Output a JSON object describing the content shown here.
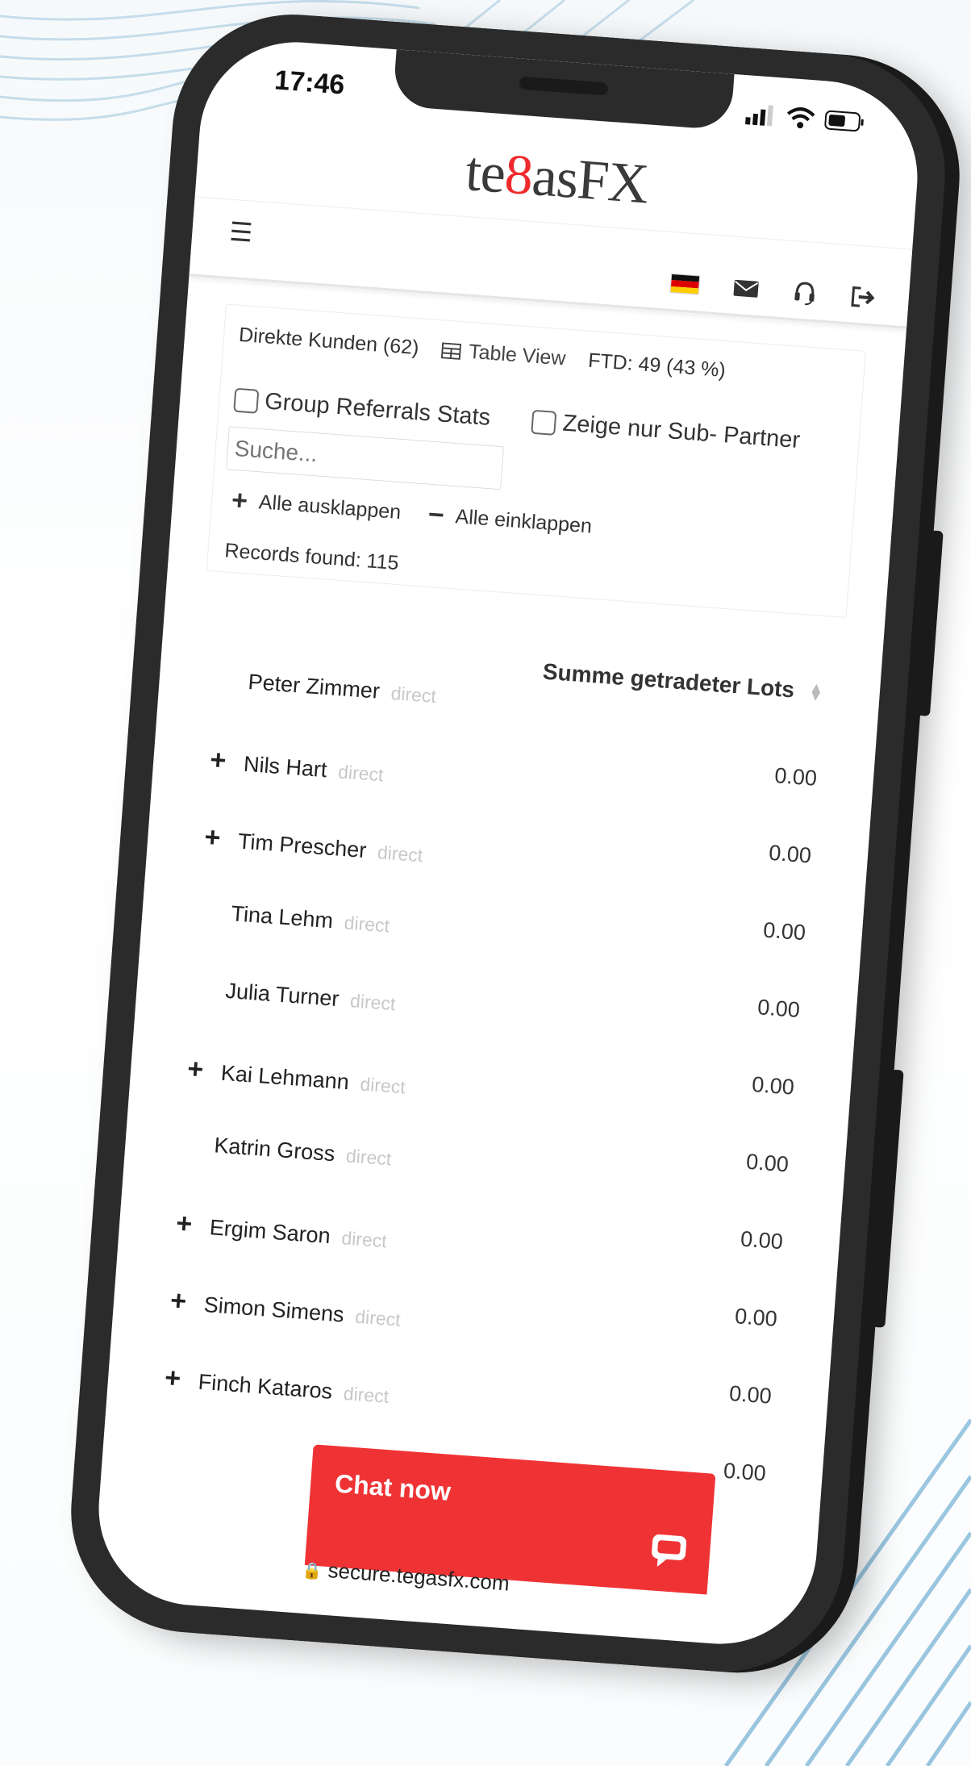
{
  "status_bar": {
    "time": "17:46"
  },
  "brand": {
    "logo_prefix": "te",
    "logo_eight": "8",
    "logo_suffix": "asFX",
    "accent": "#ef2b2d"
  },
  "topbar": {
    "menu_icon": "hamburger-icon",
    "icons": [
      "german-flag-icon",
      "envelope-icon",
      "headset-icon",
      "logout-icon"
    ]
  },
  "filters": {
    "direct_clients": "Direkte Kunden (62)",
    "table_view": "Table View",
    "ftd": "FTD: 49 (43 %)",
    "group_referrals": "Group Referrals Stats",
    "sub_partner": "Zeige nur Sub- Partner",
    "search_placeholder": "Suche...",
    "expand_all": "Alle ausklappen",
    "collapse_all": "Alle einklappen",
    "records": "Records found: 115"
  },
  "table": {
    "column_header": "Summe getradeter Lots",
    "rows": [
      {
        "name": "Peter Zimmer",
        "tag": "direct",
        "expandable": false,
        "value": ""
      },
      {
        "name": "Nils Hart",
        "tag": "direct",
        "expandable": true,
        "value": "0.00"
      },
      {
        "name": "Tim Prescher",
        "tag": "direct",
        "expandable": true,
        "value": "0.00"
      },
      {
        "name": "Tina Lehm",
        "tag": "direct",
        "expandable": false,
        "value": "0.00"
      },
      {
        "name": "Julia Turner",
        "tag": "direct",
        "expandable": false,
        "value": "0.00"
      },
      {
        "name": "Kai Lehmann",
        "tag": "direct",
        "expandable": true,
        "value": "0.00"
      },
      {
        "name": "Katrin Gross",
        "tag": "direct",
        "expandable": false,
        "value": "0.00"
      },
      {
        "name": "Ergim Saron",
        "tag": "direct",
        "expandable": true,
        "value": "0.00"
      },
      {
        "name": "Simon Simens",
        "tag": "direct",
        "expandable": true,
        "value": "0.00"
      },
      {
        "name": "Finch Kataros",
        "tag": "direct",
        "expandable": true,
        "value": "0.00"
      }
    ],
    "trailing_value": "0.00"
  },
  "chat": {
    "label": "Chat now",
    "color": "#ef3335"
  },
  "browser": {
    "url": "secure.tegasfx.com"
  }
}
